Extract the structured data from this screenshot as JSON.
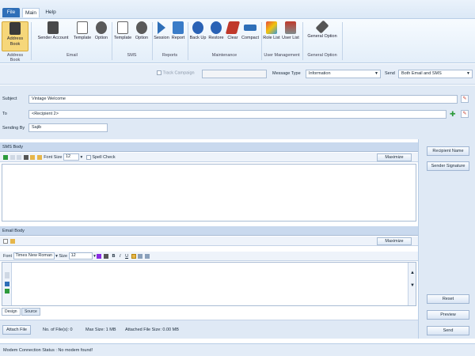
{
  "menu": {
    "file": "File",
    "main": "Main",
    "help": "Help"
  },
  "ribbon": {
    "groups": {
      "address_book": "Address Book",
      "email": "Email",
      "sms": "SMS",
      "reports": "Reports",
      "maintenance": "Maintenance",
      "user_management": "User Management",
      "general_option": "General Option"
    },
    "buttons": {
      "address_book": "Address Book",
      "sender_account": "Sender Account",
      "email_template": "Template",
      "email_option": "Option",
      "sms_template": "Template",
      "sms_option": "Option",
      "session": "Session",
      "report": "Report",
      "backup": "Back Up",
      "restore": "Restore",
      "clear": "Clear",
      "compact": "Compact",
      "role_list": "Role List",
      "user_list": "User List",
      "general_option": "General Option"
    }
  },
  "options": {
    "track_campaign": "Track Campaign",
    "message_type_label": "Message Type",
    "message_type_value": "Information",
    "send_label": "Send",
    "send_value": "Both Email and SMS"
  },
  "fields": {
    "subject_label": "Subject",
    "subject_value": "Vintage Welcome",
    "to_label": "To",
    "to_value": "<Recipient 2>",
    "sending_by_label": "Sending By",
    "sending_by_value": "Sajib"
  },
  "sms": {
    "header": "SMS Body",
    "font_size_label": "Font Size",
    "font_size_value": "12",
    "spell_check": "Spell Check",
    "maximize": "Maximize"
  },
  "email": {
    "header": "Email Body",
    "maximize": "Maximize",
    "font_label": "Font",
    "font_value": "Times New Roman",
    "size_label": "Size",
    "size_value": "12",
    "tab_design": "Design",
    "tab_source": "Source"
  },
  "right_panel": {
    "recipient_name": "Recipient Name",
    "sender_signature": "Sender Signature",
    "reset": "Reset",
    "preview": "Preview",
    "send": "Send"
  },
  "attach": {
    "button": "Attach File",
    "num_files": "No. of File(s): 0",
    "max_size": "Max Size: 1 MB",
    "attached_size": "Attached File Size: 0.00 MB"
  },
  "status": {
    "text": "Modem Connection Status : No modem found!"
  },
  "colors": {
    "accent": "#2f6fb8",
    "panel": "#dfe9f5",
    "header": "#c9d9ee"
  }
}
